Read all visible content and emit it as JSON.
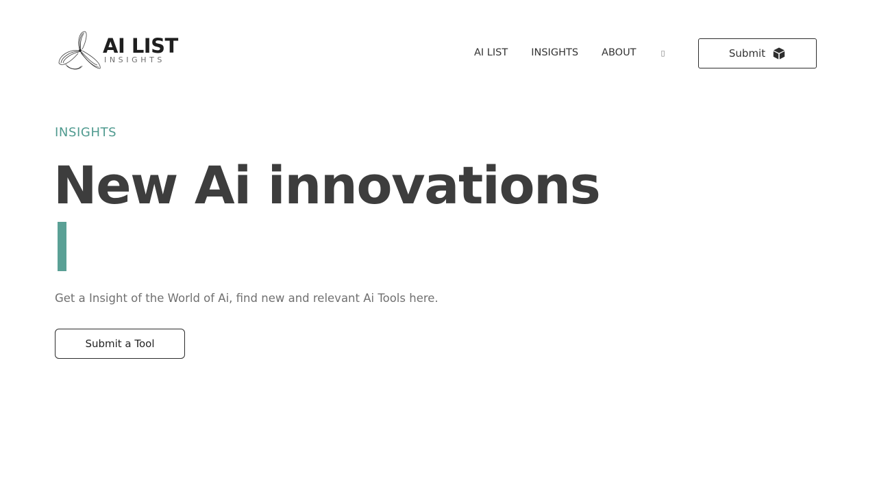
{
  "brand": {
    "name": "AI LIST",
    "tagline": "INSIGHTS"
  },
  "nav": {
    "items": [
      {
        "label": "AI LIST"
      },
      {
        "label": "INSIGHTS"
      },
      {
        "label": "ABOUT"
      }
    ],
    "extra_icon": "search-icon",
    "extra_glyph": "▯"
  },
  "header": {
    "submit_label": "Submit",
    "submit_icon": "cube-icon"
  },
  "hero": {
    "eyebrow": "INSIGHTS",
    "headline": "New Ai innovations",
    "subtitle": "Get a Insight of the World of Ai, find new and relevant Ai Tools here.",
    "cta_label": "Submit a Tool"
  },
  "colors": {
    "accent": "#5aa095",
    "eyebrow": "#4f9a8f",
    "heading": "#3d3d3d",
    "body_text": "#707070"
  }
}
